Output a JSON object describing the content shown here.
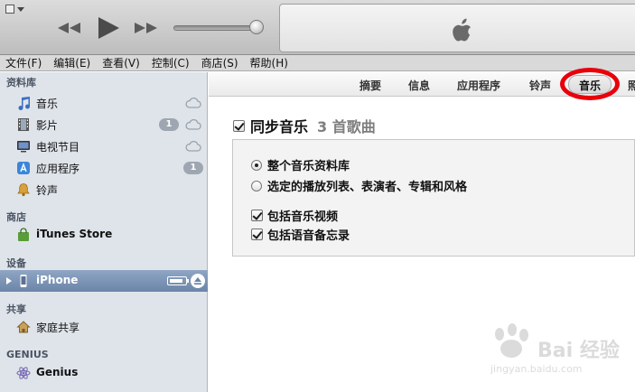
{
  "menubar": [
    "文件(F)",
    "编辑(E)",
    "查看(V)",
    "控制(C)",
    "商店(S)",
    "帮助(H)"
  ],
  "sidebar": {
    "library_header": "资料库",
    "library": [
      {
        "label": "音乐",
        "icon": "music-note-icon",
        "cloud": true
      },
      {
        "label": "影片",
        "icon": "film-icon",
        "badge": "1",
        "cloud": true
      },
      {
        "label": "电视节目",
        "icon": "tv-icon",
        "cloud": true
      },
      {
        "label": "应用程序",
        "icon": "app-store-icon",
        "badge": "1"
      },
      {
        "label": "铃声",
        "icon": "bell-icon"
      }
    ],
    "store_header": "商店",
    "store": {
      "label": "iTunes Store",
      "icon": "store-bag-icon"
    },
    "devices_header": "设备",
    "device": {
      "label": "iPhone",
      "icon": "iphone-icon"
    },
    "shared_header": "共享",
    "shared": {
      "label": "家庭共享",
      "icon": "home-icon"
    },
    "genius_header": "GENIUS",
    "genius": {
      "label": "Genius",
      "icon": "genius-atom-icon"
    }
  },
  "tabs": [
    "摘要",
    "信息",
    "应用程序",
    "铃声",
    "音乐",
    "照"
  ],
  "active_tab": "音乐",
  "sync": {
    "title": "同步音乐",
    "count": "3 首歌曲",
    "checked": true
  },
  "options": {
    "entire_library": "整个音乐资料库",
    "selected": "选定的播放列表、表演者、专辑和风格",
    "include_videos": "包括音乐视频",
    "include_voice": "包括语音备忘录"
  },
  "watermark": {
    "text": "Bai 经验",
    "url": "jingyan.baidu.com"
  },
  "colors": {
    "highlight": "#e8000b",
    "selection": "#6b85a8"
  }
}
